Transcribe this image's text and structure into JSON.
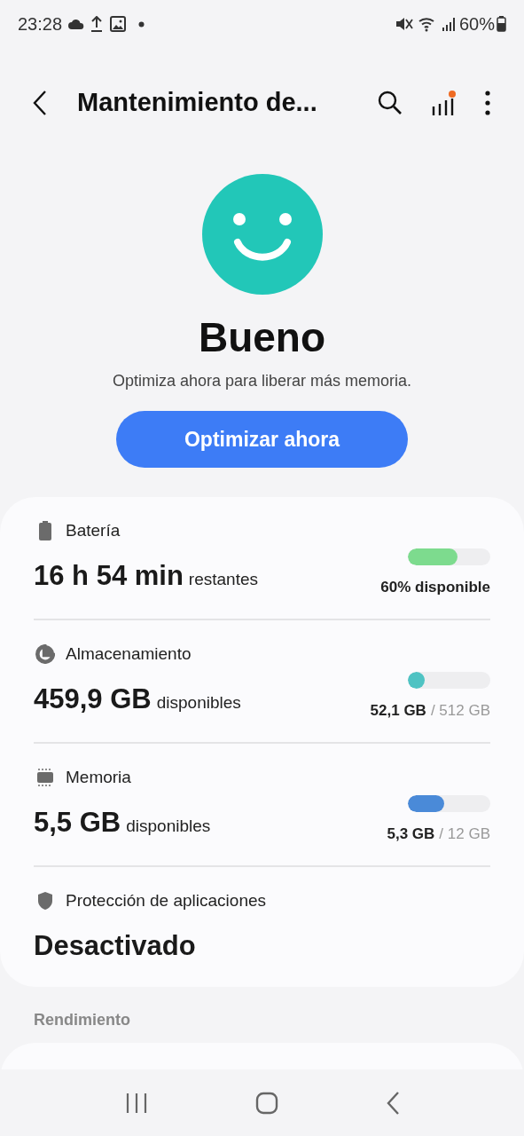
{
  "status_bar": {
    "time": "23:28",
    "battery": "60%"
  },
  "header": {
    "title": "Mantenimiento de..."
  },
  "status": {
    "title": "Bueno",
    "subtitle": "Optimiza ahora para liberar más memoria.",
    "button": "Optimizar ahora"
  },
  "items": [
    {
      "kind": "battery",
      "label": "Batería",
      "value": "16 h 54 min",
      "unit": "restantes",
      "used": "60% disponible",
      "level": 0.6,
      "color": "#7ddb8e"
    },
    {
      "kind": "storage",
      "label": "Almacenamiento",
      "value": "459,9 GB",
      "unit": "disponibles",
      "used": "52,1 GB",
      "total": "/ 512 GB",
      "level": 0.1,
      "color": "#4fc3c3"
    },
    {
      "kind": "memory",
      "label": "Memoria",
      "value": "5,5 GB",
      "unit": "disponibles",
      "used": "5,3 GB",
      "total": "/ 12 GB",
      "level": 0.44,
      "color": "#4a8ad8"
    },
    {
      "kind": "protection",
      "label": "Protección de aplicaciones",
      "value": "Desactivado"
    }
  ],
  "section": "Rendimiento"
}
